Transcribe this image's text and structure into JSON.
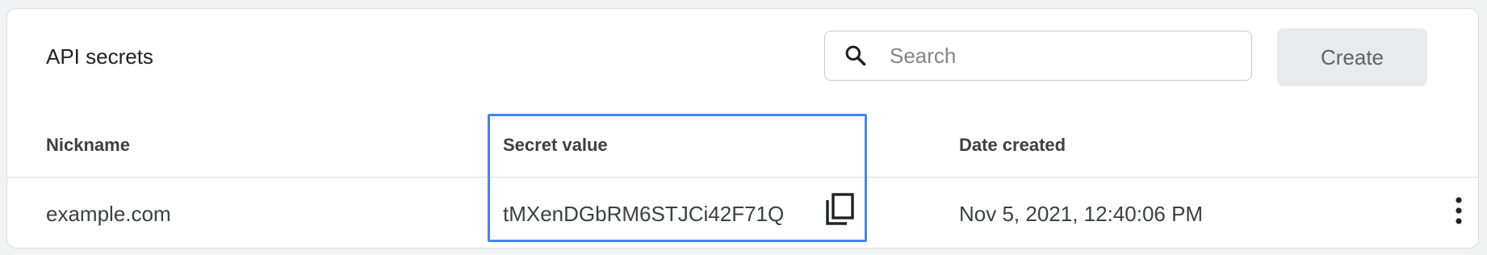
{
  "card": {
    "title": "API secrets"
  },
  "search": {
    "placeholder": "Search",
    "value": "",
    "icon": "search-icon"
  },
  "toolbar": {
    "create_label": "Create"
  },
  "table": {
    "columns": [
      "Nickname",
      "Secret value",
      "Date created"
    ],
    "rows": [
      {
        "nickname": "example.com",
        "secret_value": "tMXenDGbRM6STJCi42F71Q",
        "date_created": "Nov 5, 2021, 12:40:06 PM"
      }
    ]
  },
  "icons": {
    "copy": "copy-icon",
    "more": "more-vert-icon"
  },
  "colors": {
    "highlight": "#4285f4",
    "create_button_bg": "#e8eaed"
  }
}
